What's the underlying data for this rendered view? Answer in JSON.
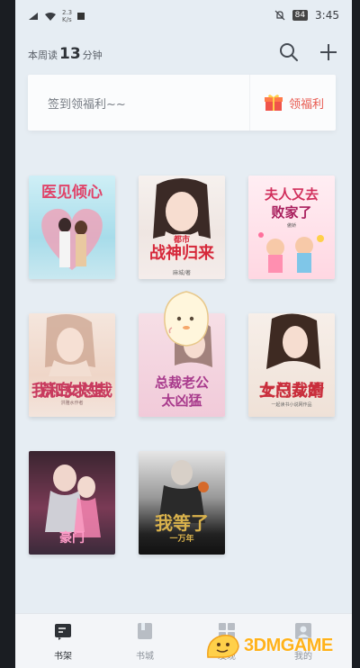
{
  "status_bar": {
    "speed_value": "2.3",
    "speed_unit": "K/s",
    "battery": "84",
    "time": "3:45"
  },
  "header": {
    "week_read_prefix": "本周读",
    "week_read_minutes": "13",
    "week_read_unit": "分钟",
    "icons": [
      "search-icon",
      "plus-icon"
    ]
  },
  "signin_banner": {
    "text": "签到领福利~~",
    "benefit_label": "领福利"
  },
  "books": [
    {
      "title": "医见倾心"
    },
    {
      "title": "战神归来",
      "subtitle": "都市",
      "author": "麻城/著"
    },
    {
      "title": "夫人又去",
      "title2": "败家了",
      "subtitle": "傲娇"
    },
    {
      "title": "荒岛求生",
      "subtitle": "我和女总裁",
      "author": "洪雅水作者"
    },
    {
      "title": "总裁老公",
      "title2": "太凶猛"
    },
    {
      "title": "上门女婿",
      "subtitle": "女总裁的",
      "author": "一起读书小说网作品"
    },
    {
      "title": "豪门"
    },
    {
      "title": "我等了",
      "title2": "一万年"
    }
  ],
  "tabbar": {
    "tabs": [
      {
        "label": "书架",
        "icon": "bookshelf-icon",
        "active": true
      },
      {
        "label": "书城",
        "icon": "book-store-icon",
        "active": false
      },
      {
        "label": "发现",
        "icon": "discover-icon",
        "active": false
      },
      {
        "label": "我的",
        "icon": "profile-icon",
        "active": false
      }
    ]
  },
  "watermark": {
    "text": "3DMGAME"
  },
  "colors": {
    "accent_red": "#e8584e",
    "background": "#e6edf3",
    "watermark_orange": "#ffb21a"
  }
}
